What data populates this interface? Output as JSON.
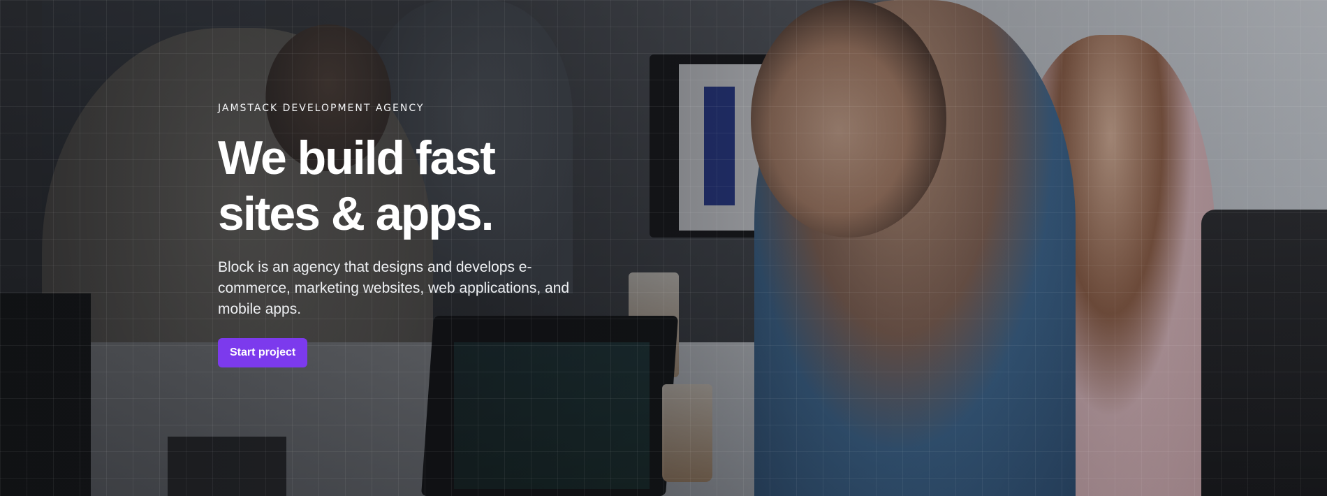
{
  "hero": {
    "eyebrow": "JAMSTACK DEVELOPMENT AGENCY",
    "headline_line1": "We build fast",
    "headline_line2": "sites & apps.",
    "description": "Block is an agency that designs and develops e-commerce, marketing websites, web applications, and mobile apps.",
    "cta_label": "Start project",
    "accent_color": "#7c3aed",
    "background_image": "team-meeting-photo"
  }
}
